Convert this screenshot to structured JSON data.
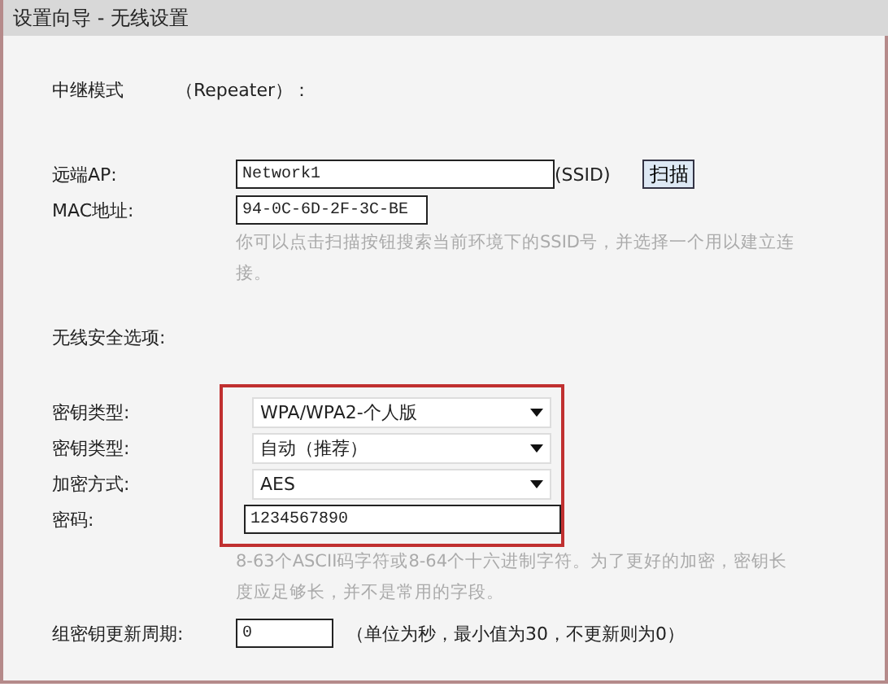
{
  "window": {
    "title": "设置向导 - 无线设置"
  },
  "mode": {
    "label": "中继模式",
    "value": "（Repeater）："
  },
  "remote_ap": {
    "label": "远端AP:",
    "value": "Network1",
    "suffix": "(SSID)",
    "button": "扫描"
  },
  "mac": {
    "label": "MAC地址:",
    "value": "94-0C-6D-2F-3C-BE"
  },
  "scan_hint": "你可以点击扫描按钮搜索当前环境下的SSID号，并选择一个用以建立连接。",
  "security": {
    "heading": "无线安全选项:",
    "fields": [
      {
        "kind": "select",
        "label": "密钥类型:",
        "value": "WPA/WPA2-个人版"
      },
      {
        "kind": "select",
        "label": "密钥类型:",
        "value": "自动（推荐）"
      },
      {
        "kind": "select",
        "label": "加密方式:",
        "value": "AES"
      },
      {
        "kind": "input",
        "label": "密码:",
        "value": "1234567890"
      }
    ],
    "hint": "8-63个ASCII码字符或8-64个十六进制字符。为了更好的加密，密钥长度应足够长，并不是常用的字段。"
  },
  "group_key": {
    "label": "组密钥更新周期:",
    "value": "0",
    "note": "（单位为秒，最小值为30，不更新则为0）"
  }
}
